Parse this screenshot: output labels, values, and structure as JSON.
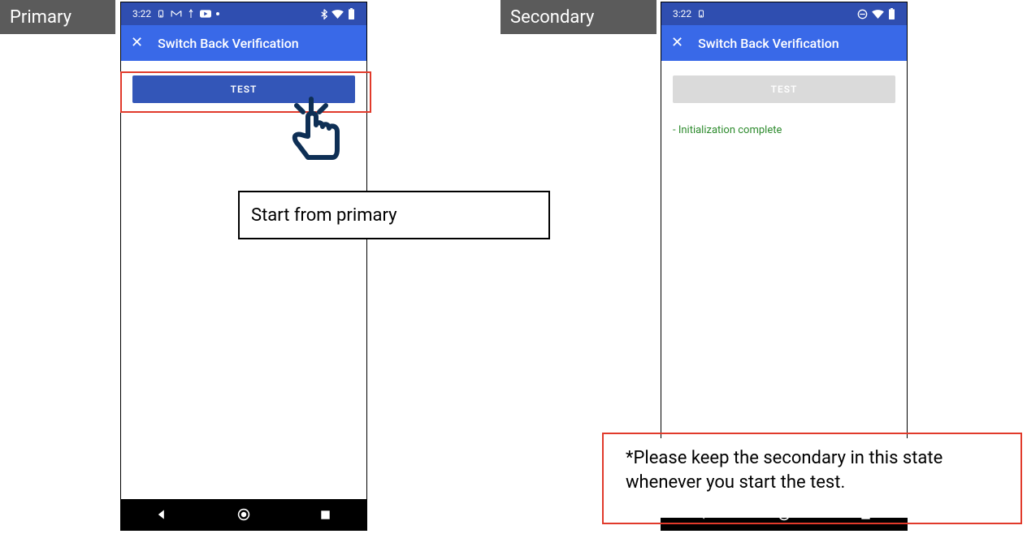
{
  "labels": {
    "primary": "Primary",
    "secondary": "Secondary"
  },
  "statusbar": {
    "time": "3:22"
  },
  "appbar": {
    "close": "✕",
    "title": "Switch Back Verification"
  },
  "buttons": {
    "test": "TEST"
  },
  "secondary_status": "- Initialization complete",
  "annotations": {
    "start": "Start from primary",
    "keep": "*Please keep the secondary in this state whenever you start the test."
  }
}
